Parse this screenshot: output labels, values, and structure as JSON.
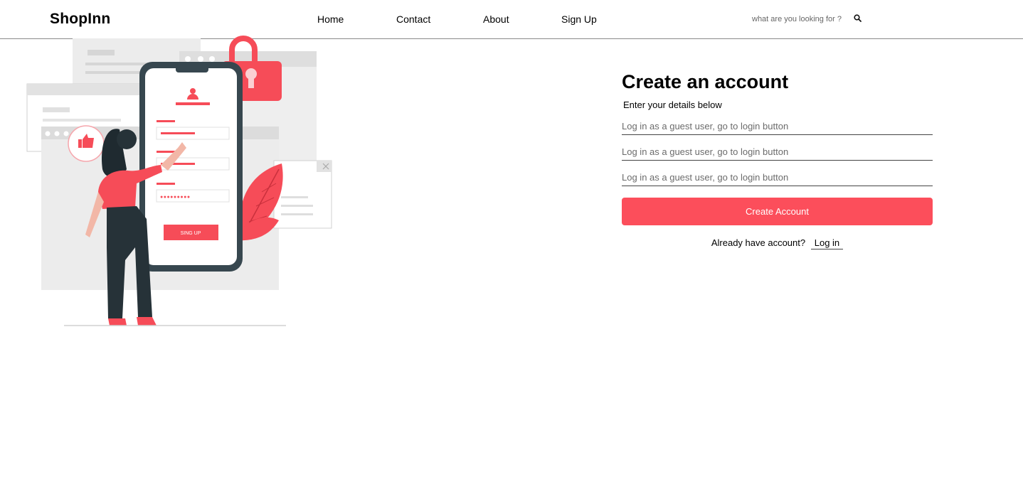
{
  "header": {
    "brand": "ShopInn",
    "nav": [
      "Home",
      "Contact",
      "About",
      "Sign Up"
    ],
    "search_placeholder": "what are you looking for ?",
    "search_icon": "search-icon"
  },
  "illustration": {
    "signup_button_label": "SING UP",
    "password_dots": "●●●●●●●●●",
    "accent_color": "#f64c58",
    "dark_color": "#263238"
  },
  "form": {
    "title": "Create an account",
    "subtitle": "Enter your details below",
    "fields": [
      {
        "placeholder": "Log in as a guest user, go to login button"
      },
      {
        "placeholder": "Log in as a guest user, go to login button"
      },
      {
        "placeholder": "Log in as a guest user, go to login button"
      }
    ],
    "submit_label": "Create Account",
    "login_prompt": "Already have account?",
    "login_link": "Log in",
    "button_color": "#fc4e5b"
  }
}
